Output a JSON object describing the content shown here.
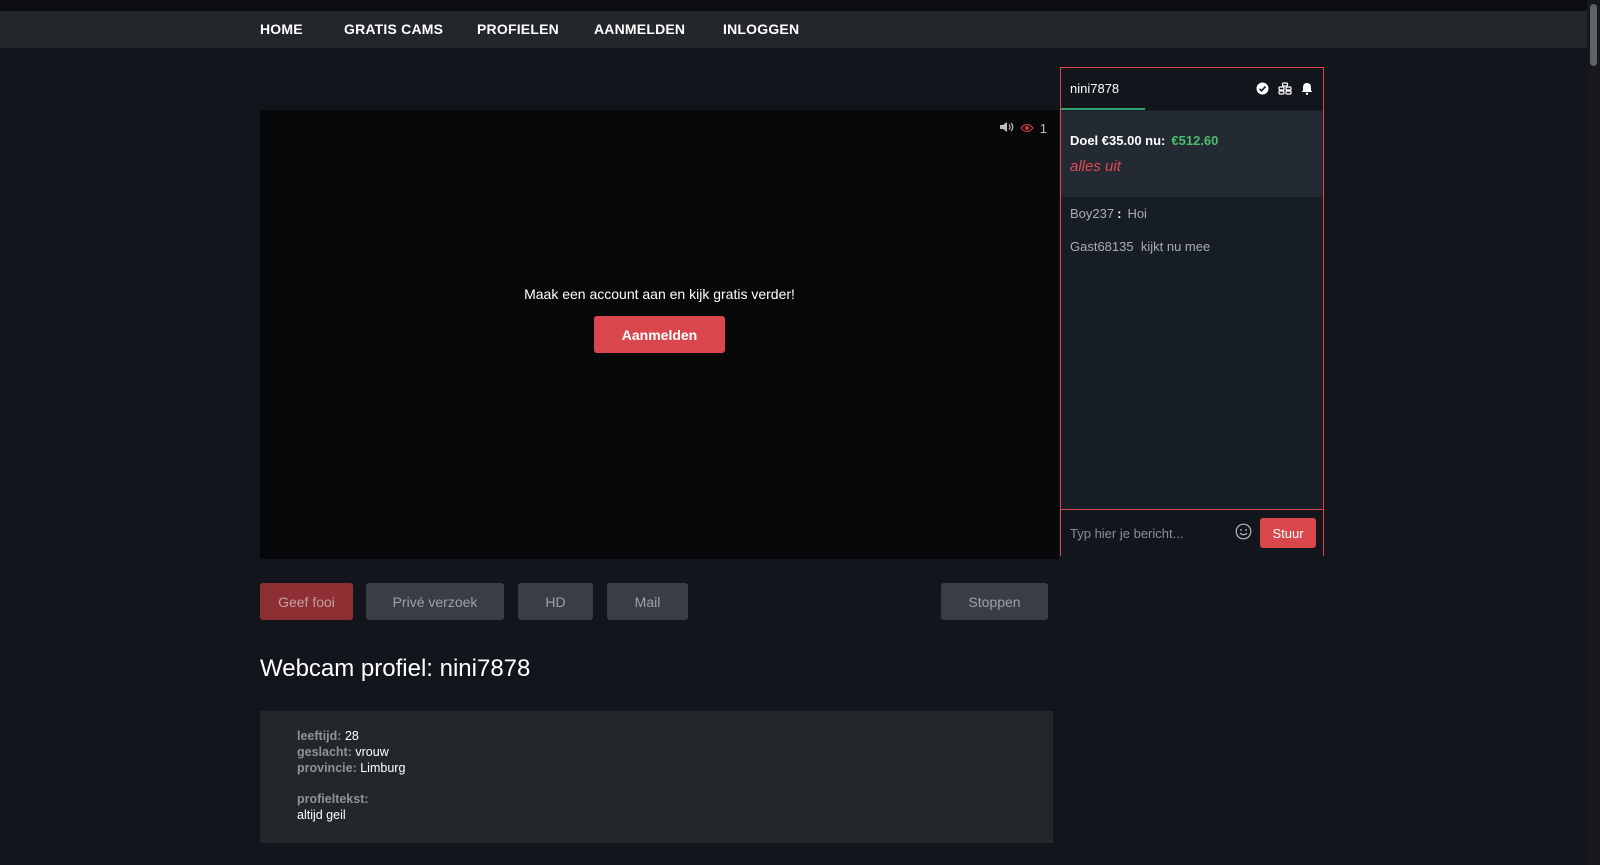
{
  "nav": {
    "items": [
      "HOME",
      "GRATIS CAMS",
      "PROFIELEN",
      "AANMELDEN",
      "INLOGGEN"
    ]
  },
  "video": {
    "viewer_count": "1",
    "cta_text": "Maak een account aan en kijk gratis verder!",
    "cta_button": "Aanmelden"
  },
  "chat": {
    "tab_label": "nini7878",
    "goal_label": "Doel €35.00 nu:",
    "goal_amount": "€512.60",
    "goal_subtitle": "alles uit",
    "messages": [
      {
        "user": "Boy237",
        "separator": ":",
        "text": "Hoi"
      },
      {
        "user": "Gast68135",
        "text": "kijkt nu mee"
      }
    ],
    "input_placeholder": "Typ hier je bericht...",
    "send_label": "Stuur"
  },
  "actions": {
    "tip": "Geef fooi",
    "private": "Privé verzoek",
    "hd": "HD",
    "mail": "Mail",
    "stop": "Stoppen"
  },
  "profile": {
    "title": "Webcam profiel: nini7878",
    "age_label": "leeftijd:",
    "age": "28",
    "gender_label": "geslacht:",
    "gender": "vrouw",
    "province_label": "provincie:",
    "province": "Limburg",
    "text_label": "profieltekst:",
    "text": "altijd geil"
  },
  "colors": {
    "accent": "#d9474c",
    "goal_green": "#4cbd6d",
    "background": "#12161c"
  },
  "icons": [
    "volume-icon",
    "eye-icon",
    "check-circle-icon",
    "coins-icon",
    "bell-icon",
    "smiley-icon"
  ]
}
